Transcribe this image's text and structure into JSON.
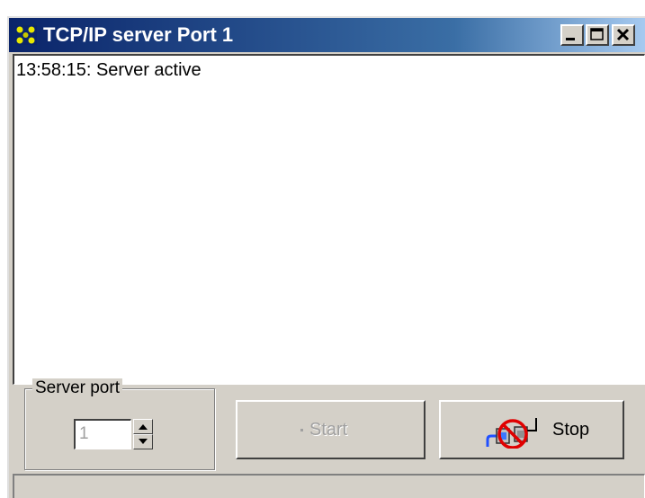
{
  "window": {
    "title": "TCP/IP server  Port 1"
  },
  "log": {
    "lines": [
      "13:58:15:  Server active"
    ]
  },
  "server_port": {
    "label": "Server port",
    "value": "1"
  },
  "buttons": {
    "start_label": "Start",
    "stop_label": "Stop"
  },
  "icons": {
    "app": "network-icon",
    "minimize": "minimize-icon",
    "maximize": "maximize-icon",
    "close": "close-icon",
    "stop": "disconnect-plug-icon"
  },
  "colors": {
    "titlebar_start": "#0a246a",
    "titlebar_end": "#a6caf0",
    "stop_symbol": "#e00000"
  }
}
